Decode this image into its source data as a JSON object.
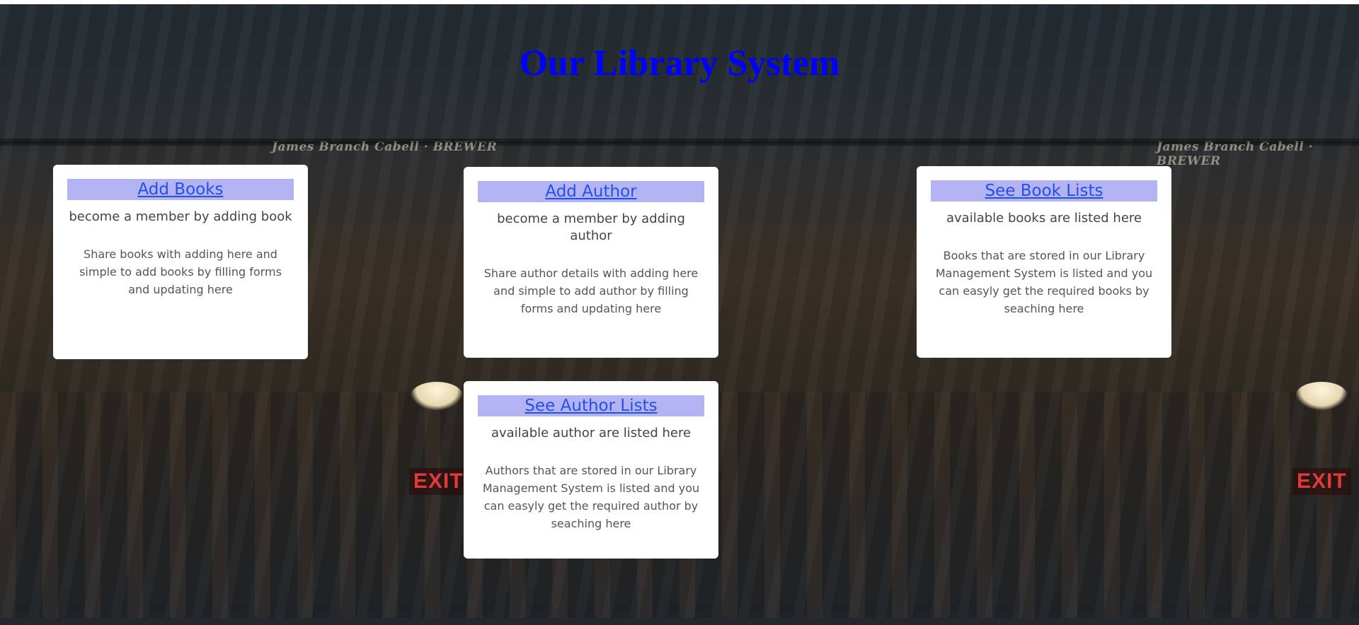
{
  "header": {
    "title": "Our Library System"
  },
  "background": {
    "book_spine_text": "James Branch Cabell · BREWER",
    "exit_sign": "EXIT"
  },
  "cards": {
    "add_books": {
      "title": "Add Books",
      "subtitle": "become a member by adding book",
      "description": "Share books with adding here and simple to add books by filling forms and updating here"
    },
    "add_author": {
      "title": "Add Author",
      "subtitle": "become a member by adding author",
      "description": "Share author details with adding here and simple to add author by filling forms and updating here"
    },
    "see_book_lists": {
      "title": "See Book Lists",
      "subtitle": "available books are listed here",
      "description": "Books that are stored in our Library Management System is listed and you can easyly get the required books by seaching here"
    },
    "see_author_lists": {
      "title": "See Author Lists",
      "subtitle": "available author are listed here",
      "description": "Authors that are stored in our Library Management System is listed and you can easyly get the required author by seaching here"
    }
  },
  "colors": {
    "title": "#0000ff",
    "card_header_bg": "#b3b3f4",
    "link": "#2250e8",
    "card_bg": "#ffffff"
  }
}
